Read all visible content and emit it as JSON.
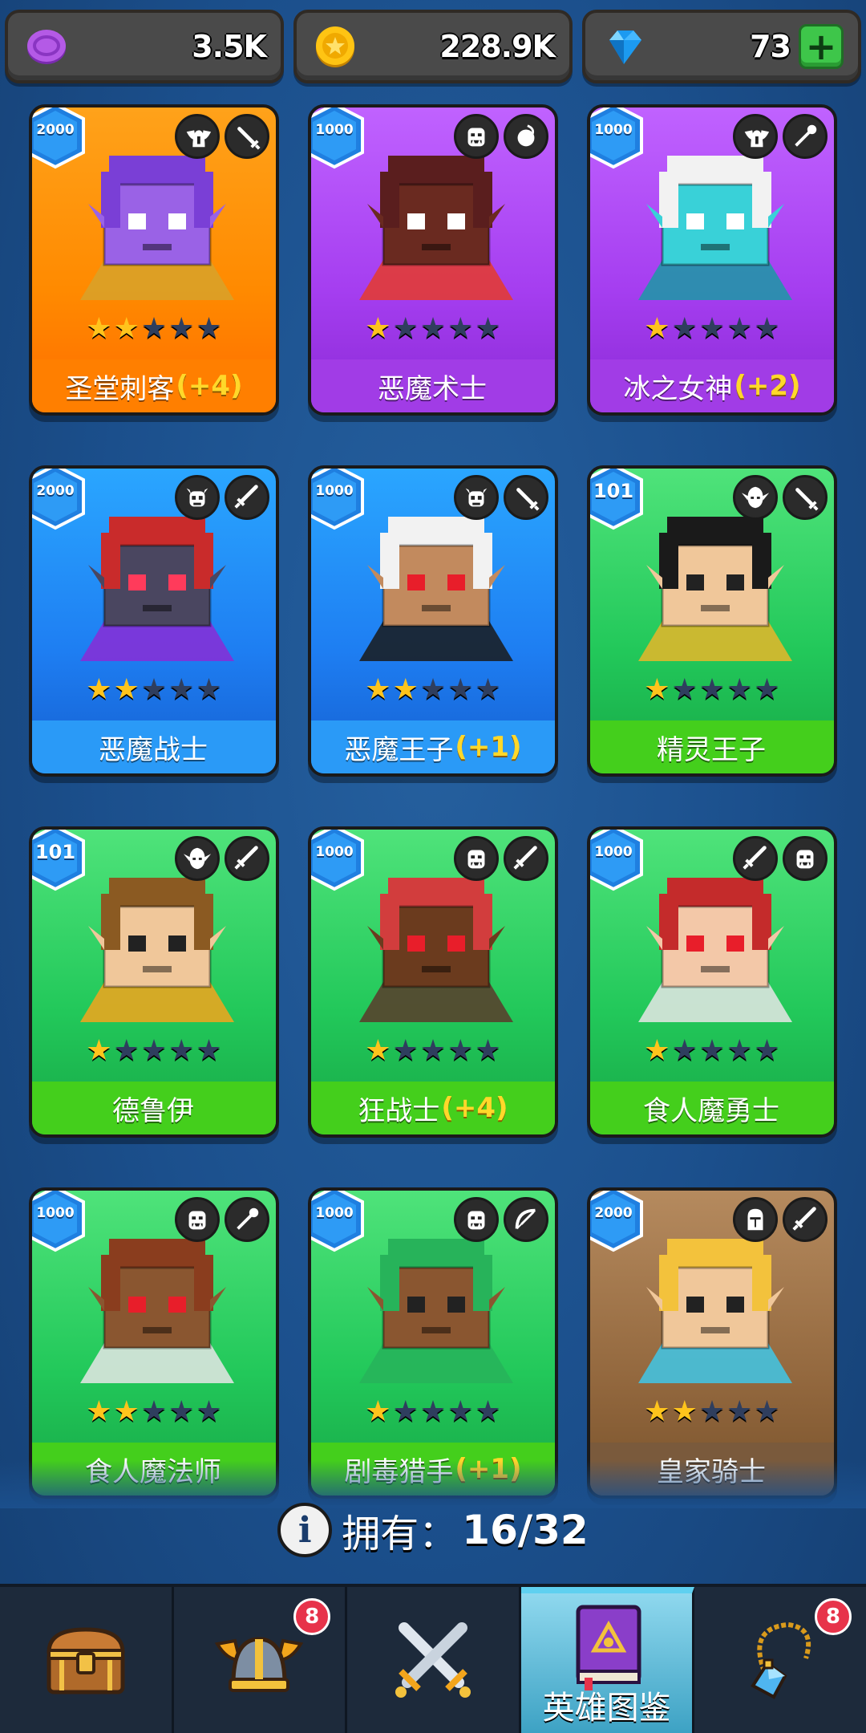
{
  "currencies": [
    {
      "icon": "purple-token-icon",
      "value": "3.5K"
    },
    {
      "icon": "gold-coin-icon",
      "value": "228.9K"
    },
    {
      "icon": "blue-gem-icon",
      "value": "73",
      "plus": "+"
    }
  ],
  "heroes": [
    {
      "name": "圣堂刺客",
      "bonus": "(+4)",
      "badge": "2000",
      "stars": 2,
      "color": "orange",
      "icons": [
        "winged-helmet-icon",
        "dagger-icon"
      ]
    },
    {
      "name": "恶魔术士",
      "bonus": "",
      "badge": "1000",
      "stars": 1,
      "color": "purple",
      "icons": [
        "ogre-face-icon",
        "magic-orb-icon"
      ]
    },
    {
      "name": "冰之女神",
      "bonus": "(+2)",
      "badge": "1000",
      "stars": 1,
      "color": "purple",
      "icons": [
        "winged-helmet-icon",
        "staff-icon"
      ]
    },
    {
      "name": "恶魔战士",
      "bonus": "",
      "badge": "2000",
      "stars": 2,
      "color": "blue",
      "icons": [
        "demon-skull-icon",
        "sword-icon"
      ]
    },
    {
      "name": "恶魔王子",
      "bonus": "(+1)",
      "badge": "1000",
      "stars": 2,
      "color": "blue",
      "icons": [
        "demon-skull-icon",
        "dagger-icon"
      ]
    },
    {
      "name": "精灵王子",
      "bonus": "",
      "badge": "101",
      "stars": 1,
      "color": "green",
      "icons": [
        "elf-face-icon",
        "dagger-icon"
      ]
    },
    {
      "name": "德鲁伊",
      "bonus": "",
      "badge": "101",
      "stars": 1,
      "color": "green",
      "icons": [
        "elf-face-icon",
        "sword-icon"
      ]
    },
    {
      "name": "狂战士",
      "bonus": "(+4)",
      "badge": "1000",
      "stars": 1,
      "color": "green",
      "icons": [
        "ogre-face-icon",
        "sword-icon"
      ]
    },
    {
      "name": "食人魔勇士",
      "bonus": "",
      "badge": "1000",
      "stars": 1,
      "color": "green",
      "icons": [
        "sword-icon",
        "ogre-face-icon"
      ]
    },
    {
      "name": "食人魔法师",
      "bonus": "",
      "badge": "1000",
      "stars": 2,
      "color": "green",
      "icons": [
        "ogre-face-icon",
        "staff-icon"
      ]
    },
    {
      "name": "剧毒猎手",
      "bonus": "(+1)",
      "badge": "1000",
      "stars": 1,
      "color": "green",
      "icons": [
        "ogre-face-icon",
        "bow-icon"
      ]
    },
    {
      "name": "皇家骑士",
      "bonus": "",
      "badge": "2000",
      "stars": 2,
      "color": "tan",
      "icons": [
        "knight-helmet-icon",
        "sword-icon"
      ]
    }
  ],
  "owned": {
    "label": "拥有：",
    "count": "16/32"
  },
  "nav": [
    {
      "icon": "treasure-chest-icon",
      "badge": "",
      "label": ""
    },
    {
      "icon": "viking-helmet-icon",
      "badge": "8",
      "label": ""
    },
    {
      "icon": "crossed-swords-icon",
      "badge": "",
      "label": ""
    },
    {
      "icon": "hero-book-icon",
      "badge": "",
      "label": "英雄图鉴",
      "active": true
    },
    {
      "icon": "amulet-icon",
      "badge": "8",
      "label": ""
    }
  ],
  "colors": {
    "background": "#1b4f8c",
    "orange": "#ff7f00",
    "purple": "#a13ce6",
    "blue": "#2a9af7",
    "green": "#44cf1c",
    "tan": "#7a5a3c",
    "star": "#ffc41c",
    "bonus": "#ffd82a",
    "badge": "#e7334a"
  }
}
